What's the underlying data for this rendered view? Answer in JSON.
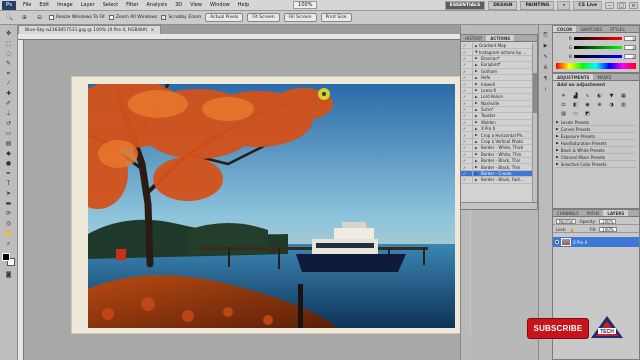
{
  "menu": {
    "logo": "Ps",
    "items": [
      "File",
      "Edit",
      "Image",
      "Layer",
      "Select",
      "Filter",
      "Analysis",
      "3D",
      "View",
      "Window",
      "Help"
    ],
    "zoom": "100%",
    "workspaces": [
      "ESSENTIALS",
      "DESIGN",
      "PAINTING"
    ],
    "cs_live": "CS Live"
  },
  "options": {
    "resize_windows": "Resize Windows To Fit",
    "zoom_all": "Zoom All Windows",
    "scrubby_zoom": "Scrubby Zoom",
    "actual_pixels": "Actual Pixels",
    "fit_screen": "Fit Screen",
    "fill_screen": "Fill Screen",
    "print_size": "Print Size"
  },
  "document": {
    "tab_title": "Blue-Sky-a2363857531.jpg @ 100% (X Pro II, RGB/8#)"
  },
  "actions_panel": {
    "tabs": [
      "HISTORY",
      "ACTIONS"
    ],
    "rows": [
      {
        "label": "Gradient Map",
        "indent": false,
        "selected": false
      },
      {
        "label": "Instagram actions by ...",
        "indent": false,
        "selected": false,
        "folder": true
      },
      {
        "label": "Brannan*",
        "indent": true,
        "selected": false
      },
      {
        "label": "Earlybird*",
        "indent": true,
        "selected": false
      },
      {
        "label": "Gotham",
        "indent": true,
        "selected": false
      },
      {
        "label": "Hefe",
        "indent": true,
        "selected": false
      },
      {
        "label": "Inkwell",
        "indent": true,
        "selected": false
      },
      {
        "label": "Lomo-fi",
        "indent": true,
        "selected": false
      },
      {
        "label": "Lord Kelvin",
        "indent": true,
        "selected": false
      },
      {
        "label": "Nashville",
        "indent": true,
        "selected": false
      },
      {
        "label": "Sutro*",
        "indent": true,
        "selected": false
      },
      {
        "label": "Toaster",
        "indent": true,
        "selected": false
      },
      {
        "label": "Walden",
        "indent": true,
        "selected": false
      },
      {
        "label": "X Pro II",
        "indent": true,
        "selected": false
      },
      {
        "label": "Crop a Horizontal Ph...",
        "indent": true,
        "selected": false
      },
      {
        "label": "Crop a Vertical Photo",
        "indent": true,
        "selected": false
      },
      {
        "label": "Border - White, Thick",
        "indent": true,
        "selected": false
      },
      {
        "label": "Border - White, Thin",
        "indent": true,
        "selected": false
      },
      {
        "label": "Border - Black, Thin",
        "indent": true,
        "selected": false
      },
      {
        "label": "Border - Black, Thin",
        "indent": true,
        "selected": false
      },
      {
        "label": "Border - Cream",
        "indent": true,
        "selected": true
      },
      {
        "label": "Border - Black, Fadi...",
        "indent": true,
        "selected": false
      }
    ]
  },
  "color_panel": {
    "tabs": [
      "COLOR",
      "SWATCHES",
      "STYLES"
    ],
    "channels": [
      {
        "label": "R",
        "value": "0",
        "gradient": "#ff0000"
      },
      {
        "label": "G",
        "value": "0",
        "gradient": "#00ff00"
      },
      {
        "label": "B",
        "value": "0",
        "gradient": "#0000ff"
      }
    ]
  },
  "adjustments": {
    "tabs": [
      "ADJUSTMENTS",
      "MASKS"
    ],
    "title": "Add an adjustment",
    "presets": [
      "Levels Presets",
      "Curves Presets",
      "Exposure Presets",
      "Hue/Saturation Presets",
      "Black & White Presets",
      "Channel Mixer Presets",
      "Selective Color Presets"
    ]
  },
  "layers_panel": {
    "tabs": [
      "CHANNELS",
      "PATHS",
      "LAYERS"
    ],
    "blend_mode": "Normal",
    "opacity_label": "Opacity:",
    "opacity": "100%",
    "lock_label": "Lock:",
    "fill_label": "Fill:",
    "fill": "100%",
    "layer_name": "X Pro II"
  },
  "watermark": {
    "subscribe": "SUBSCRIBE",
    "logo_text": "TECH"
  },
  "colors": {
    "selection": "#3d78d8",
    "subscribe": "#c9141c"
  }
}
